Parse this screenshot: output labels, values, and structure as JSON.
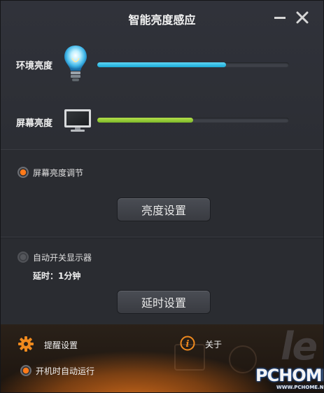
{
  "window": {
    "title": "智能亮度感应"
  },
  "ambient": {
    "label": "环境亮度",
    "level_percent": 67,
    "icon": "light-bulb-icon",
    "fill_color": "#2bbde8"
  },
  "screen": {
    "label": "屏幕亮度",
    "level_percent": 50,
    "icon": "monitor-icon",
    "fill_color": "#95cc34"
  },
  "brightness_mode": {
    "label": "屏幕亮度调节",
    "selected": true,
    "button_label": "亮度设置"
  },
  "auto_display": {
    "label": "自动开关显示器",
    "selected": false,
    "delay_text": "延时：1分钟",
    "button_label": "延时设置"
  },
  "footer": {
    "reminder_label": "提醒设置",
    "about_label": "关于",
    "autostart_label": "开机时自动运行",
    "autostart_selected": true,
    "watermark_main": "PCHOME",
    "watermark_sub": "WWW.PCHOME.NET"
  },
  "colors": {
    "accent_orange": "#ff7a1a",
    "background": "#2b2d31"
  }
}
